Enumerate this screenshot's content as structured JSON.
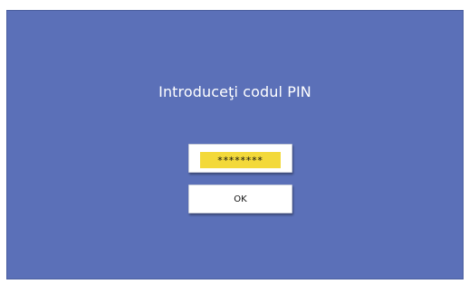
{
  "dialog": {
    "title": "Introduceţi codul PIN",
    "pin_masked": "********",
    "ok_label": "OK"
  },
  "colors": {
    "background": "#5b70b8",
    "button": "#ffffff",
    "pin_highlight": "#f3d93a",
    "text_light": "#ffffff",
    "text_dark": "#111111"
  }
}
